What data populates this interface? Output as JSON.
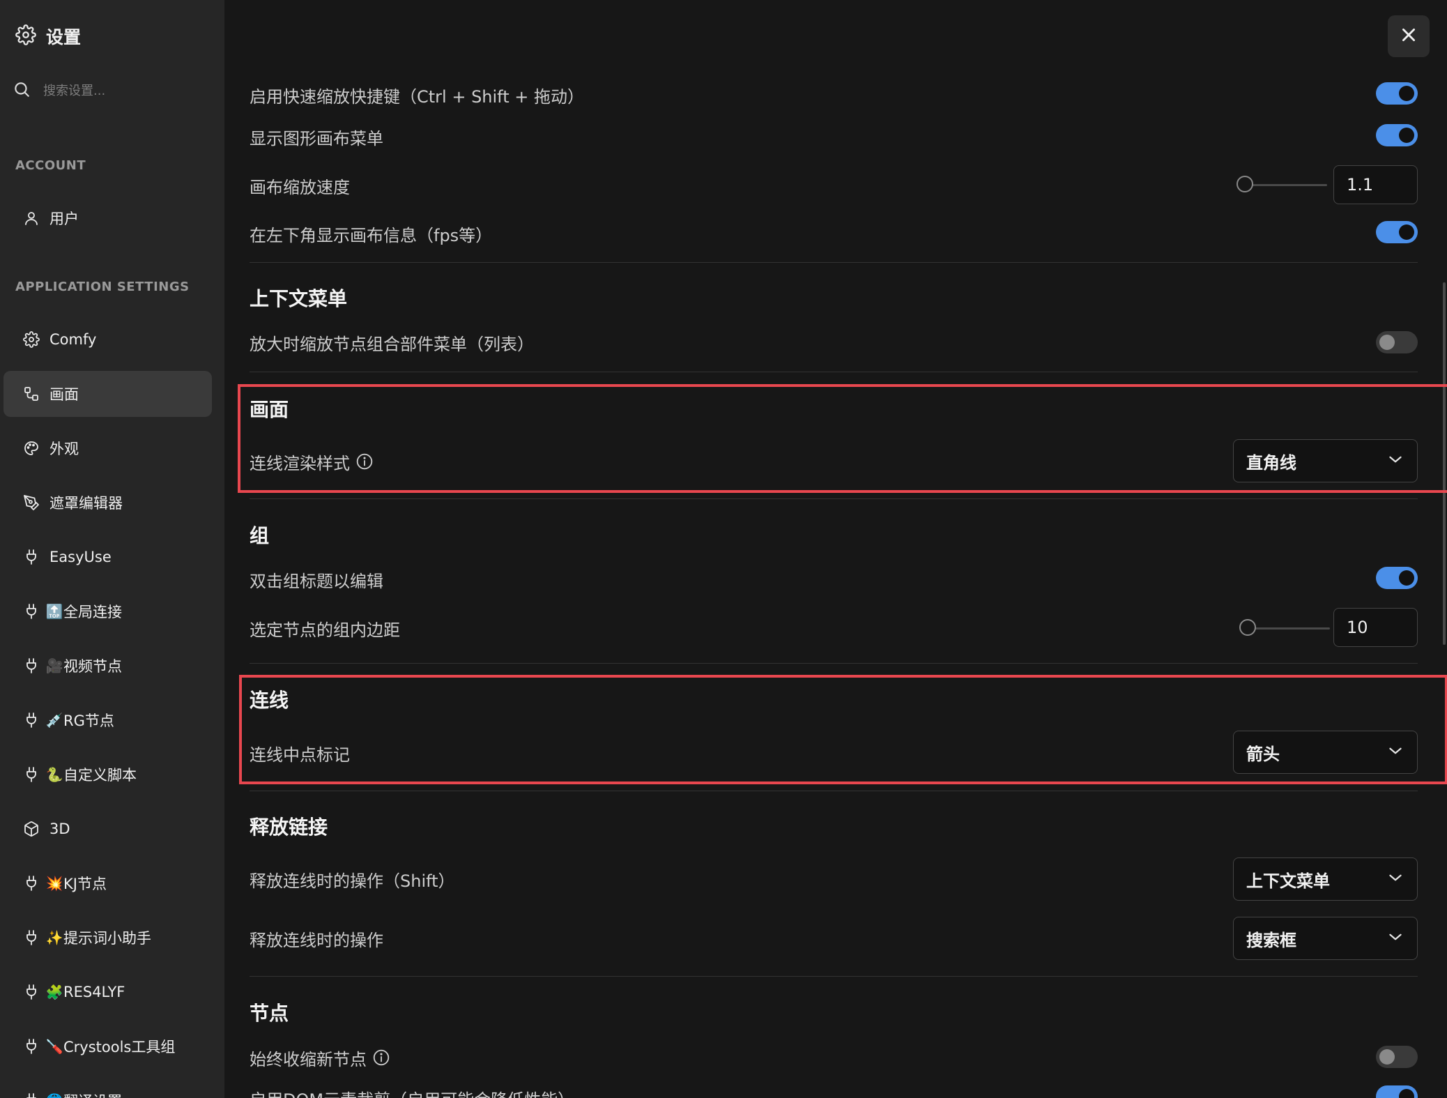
{
  "sidebar": {
    "title": "设置",
    "search_placeholder": "搜索设置...",
    "sections": {
      "account": "ACCOUNT",
      "app": "APPLICATION SETTINGS"
    },
    "items": [
      {
        "label": "用户",
        "icon": "user-icon"
      },
      {
        "label": "Comfy",
        "icon": "gear-icon"
      },
      {
        "label": "画面",
        "icon": "nodes-icon",
        "active": true
      },
      {
        "label": "外观",
        "icon": "palette-icon"
      },
      {
        "label": "遮罩编辑器",
        "icon": "pen-tool-icon"
      },
      {
        "label": "EasyUse",
        "icon": "plug-icon"
      },
      {
        "label": "全局连接",
        "icon": "plug-icon",
        "emoji": "🔝"
      },
      {
        "label": "视频节点",
        "icon": "plug-icon",
        "emoji": "🎥"
      },
      {
        "label": "RG节点",
        "icon": "plug-icon",
        "emoji": "💉"
      },
      {
        "label": "自定义脚本",
        "icon": "plug-icon",
        "emoji": "🐍"
      },
      {
        "label": "3D",
        "icon": "cube-icon"
      },
      {
        "label": "KJ节点",
        "icon": "plug-icon",
        "emoji": "💥"
      },
      {
        "label": "提示词小助手",
        "icon": "plug-icon",
        "emoji": "✨"
      },
      {
        "label": "RES4LYF",
        "icon": "plug-icon",
        "emoji": "🧩"
      },
      {
        "label": "Crystools工具组",
        "icon": "plug-icon",
        "emoji": "🪛"
      },
      {
        "label": "翻译设置",
        "icon": "plug-icon",
        "emoji": "🌐"
      }
    ]
  },
  "main": {
    "rows_top": [
      {
        "label": "启用快速缩放快捷键（Ctrl + Shift + 拖动）",
        "toggle": true
      },
      {
        "label": "显示图形画布菜单",
        "toggle": true
      },
      {
        "label": "画布缩放速度",
        "value": "1.1"
      },
      {
        "label": "在左下角显示画布信息（fps等）",
        "toggle": true
      }
    ],
    "context_menu": {
      "heading": "上下文菜单",
      "rows": [
        {
          "label": "放大时缩放节点组合部件菜单（列表）",
          "toggle": false
        }
      ]
    },
    "canvas": {
      "heading": "画面",
      "rows": [
        {
          "label": "连线渲染样式",
          "value": "直角线"
        }
      ]
    },
    "group": {
      "heading": "组",
      "rows": [
        {
          "label": "双击组标题以编辑",
          "toggle": true
        },
        {
          "label": "选定节点的组内边距",
          "value": "10"
        }
      ]
    },
    "link": {
      "heading": "连线",
      "rows": [
        {
          "label": "连线中点标记",
          "value": "箭头"
        }
      ]
    },
    "link_release": {
      "heading": "释放链接",
      "rows": [
        {
          "label": "释放连线时的操作（Shift）",
          "value": "上下文菜单"
        },
        {
          "label": "释放连线时的操作",
          "value": "搜索框"
        }
      ]
    },
    "node": {
      "heading": "节点",
      "rows": [
        {
          "label": "始终收缩新节点",
          "toggle": false
        },
        {
          "label": "启用DOM元素裁剪（启用可能会降低性能）",
          "toggle": true
        }
      ]
    }
  },
  "colors": {
    "accent": "#4b8fe8",
    "highlight": "#e8474f"
  }
}
